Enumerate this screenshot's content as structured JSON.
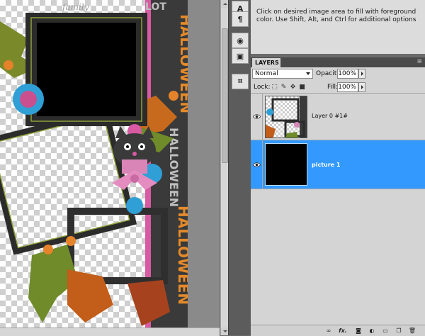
{
  "tool_info": {
    "hint": "Click on desired image area to fill with foreground color.  Use Shift, Alt, and Ctrl for additional options"
  },
  "dock": {
    "buttons": [
      {
        "icon": "type-tool-icon",
        "glyph": "A"
      },
      {
        "icon": "paragraph-icon",
        "glyph": "¶"
      },
      {
        "icon": "brush-preset-icon",
        "glyph": "◉"
      },
      {
        "icon": "clone-source-icon",
        "glyph": "▣"
      },
      {
        "icon": "crop-tool-icon",
        "glyph": "⌗"
      }
    ]
  },
  "layers_panel": {
    "tab_label": "LAYERS",
    "blend_mode": "Normal",
    "opacity_label": "Opacity:",
    "opacity_value": "100%",
    "lock_label": "Lock:",
    "fill_label": "Fill:",
    "fill_value": "100%",
    "layers": [
      {
        "name": "Layer 0 #1#",
        "visible": true,
        "selected": false
      },
      {
        "name": "picture 1",
        "visible": true,
        "selected": true
      }
    ],
    "bottom_icons": [
      "link-layers-icon",
      "fx-icon",
      "layer-mask-icon",
      "adjustment-layer-icon",
      "group-folder-icon",
      "new-layer-icon",
      "delete-layer-icon"
    ],
    "fx_text": "fx."
  },
  "canvas": {
    "side_words": [
      "HALLOWEEN",
      "HALLOWEEN",
      "HALLOWEEN"
    ],
    "top_words": [
      "family",
      "LOT"
    ]
  },
  "colors": {
    "selection": "#3399ff",
    "panel_bg": "#d4d4d4",
    "dock_bg": "#5c5c5c",
    "frame_black": "#000000",
    "accent_orange": "#d9862a",
    "accent_pink": "#d957a3"
  }
}
